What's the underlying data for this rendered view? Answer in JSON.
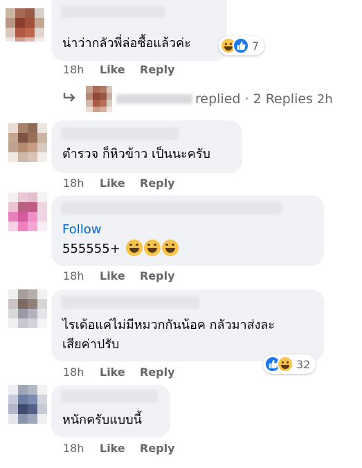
{
  "comments": [
    {
      "text": "น่าว่ากลัวพี่ล่อซื้อแล้วค่ะ",
      "time": "18h",
      "like_label": "Like",
      "reply_label": "Reply",
      "reaction_count": "7",
      "reaction_icons": [
        "haha-icon",
        "like-icon"
      ]
    },
    {
      "text": "ตำรวจ ก็หิวข้าว เป็นนะครับ",
      "time": "18h",
      "like_label": "Like",
      "reply_label": "Reply"
    },
    {
      "follow_label": "Follow",
      "text": "555555+",
      "time": "18h",
      "like_label": "Like",
      "reply_label": "Reply"
    },
    {
      "text_line1": "ไรเด้อแค่ไม่มีหมวกกันน้อค กลัวมาส่งละ",
      "text_line2": "เสียค่าปรับ",
      "time": "18h",
      "like_label": "Like",
      "reply_label": "Reply",
      "reaction_count": "32",
      "reaction_icons": [
        "like-icon",
        "haha-icon"
      ]
    },
    {
      "text": "หนักครับแบบนี้",
      "time": "18h",
      "like_label": "Like",
      "reply_label": "Reply"
    }
  ],
  "replies_summary": {
    "label": "replied · 2 Replies",
    "time": "2h"
  },
  "colors": {
    "bubble_bg": "#f0f2f5",
    "meta_text": "#65676b",
    "follow_link": "#0064d1",
    "like_blue": "#1877f2",
    "haha_yellow": "#f7c34a"
  }
}
